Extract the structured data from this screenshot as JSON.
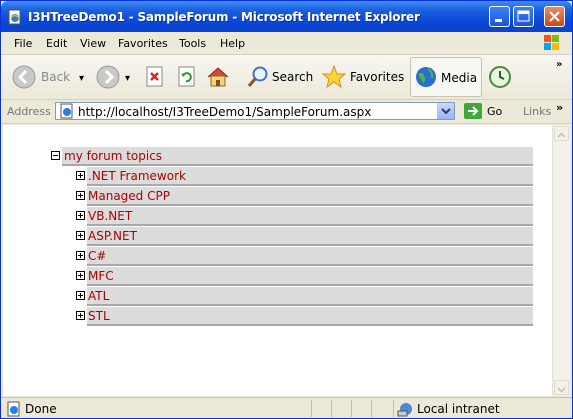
{
  "window": {
    "title": "I3HTreeDemo1 - SampleForum - Microsoft Internet Explorer"
  },
  "menu": {
    "items": [
      "File",
      "Edit",
      "View",
      "Favorites",
      "Tools",
      "Help"
    ]
  },
  "toolbar": {
    "back_label": "Back",
    "search_label": "Search",
    "favorites_label": "Favorites",
    "media_label": "Media"
  },
  "address": {
    "label": "Address",
    "url": "http://localhost/I3TreeDemo1/SampleForum.aspx",
    "go_label": "Go",
    "links_label": "Links"
  },
  "tree": {
    "root_label": "my forum topics",
    "children": [
      ".NET Framework",
      "Managed CPP",
      "VB.NET",
      "ASP.NET",
      "C#",
      "MFC",
      "ATL",
      "STL"
    ]
  },
  "status": {
    "text": "Done",
    "zone": "Local intranet"
  },
  "colors": {
    "title_bar": "#0a46d8",
    "tree_text": "#b00000",
    "tree_row_bg": "#dcdcdc"
  }
}
